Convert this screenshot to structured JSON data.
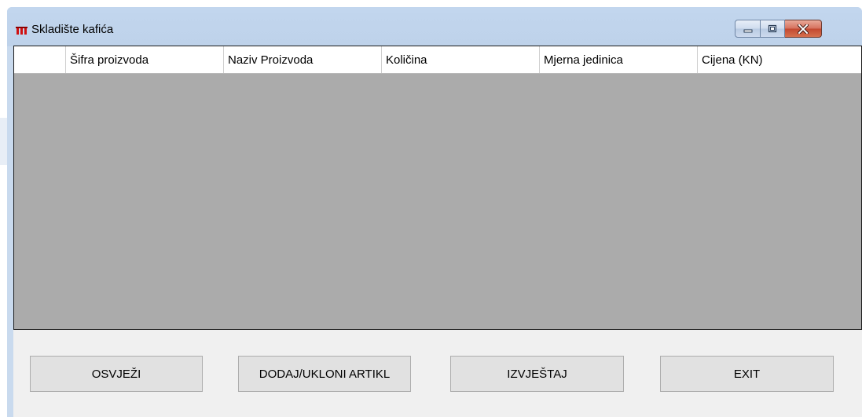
{
  "window": {
    "title": "Skladište kafića",
    "icon": "app-icon",
    "controls": {
      "minimize": "minimize-icon",
      "maximize": "maximize-icon",
      "close": "close-icon"
    }
  },
  "grid": {
    "columns": [
      "Šifra proizvoda",
      "Naziv Proizvoda",
      "Količina",
      "Mjerna jedinica",
      "Cijena (KN)"
    ],
    "rows": [],
    "background_color": "#ababab"
  },
  "buttons": {
    "refresh": "OSVJEŽI",
    "add_remove": "DODAJ/UKLONI ARTIKL",
    "report": "IZVJEŠTAJ",
    "exit": "EXIT"
  },
  "colors": {
    "title_bar": "#c2d6ee",
    "close_button": "#c9503a",
    "client_background": "#f0f0f0"
  }
}
